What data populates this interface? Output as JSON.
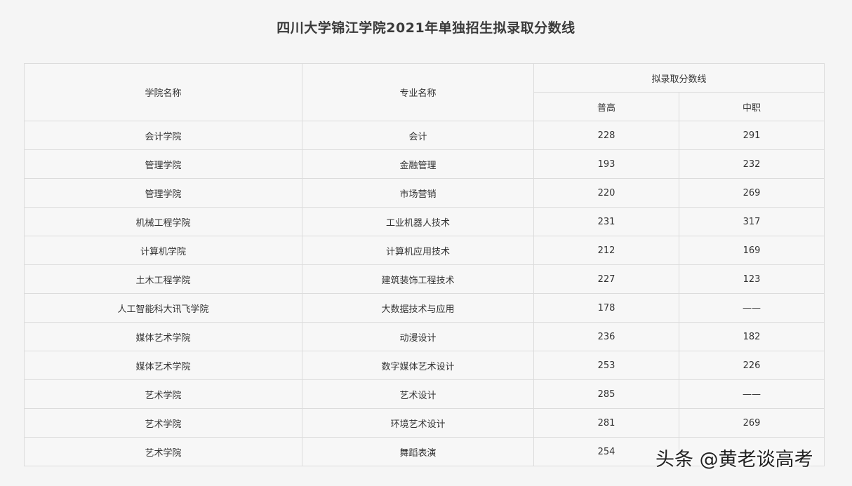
{
  "title": "四川大学锦江学院2021年单独招生拟录取分数线",
  "table": {
    "headers": {
      "college": "学院名称",
      "major": "专业名称",
      "score_group": "拟录取分数线",
      "putong": "普高",
      "zhongzhi": "中职"
    },
    "rows": [
      {
        "college": "会计学院",
        "major": "会计",
        "putong": "228",
        "zhongzhi": "291"
      },
      {
        "college": "管理学院",
        "major": "金融管理",
        "putong": "193",
        "zhongzhi": "232"
      },
      {
        "college": "管理学院",
        "major": "市场营销",
        "putong": "220",
        "zhongzhi": "269"
      },
      {
        "college": "机械工程学院",
        "major": "工业机器人技术",
        "putong": "231",
        "zhongzhi": "317"
      },
      {
        "college": "计算机学院",
        "major": "计算机应用技术",
        "putong": "212",
        "zhongzhi": "169"
      },
      {
        "college": "土木工程学院",
        "major": "建筑装饰工程技术",
        "putong": "227",
        "zhongzhi": "123"
      },
      {
        "college": "人工智能科大讯飞学院",
        "major": "大数据技术与应用",
        "putong": "178",
        "zhongzhi": "——"
      },
      {
        "college": "媒体艺术学院",
        "major": "动漫设计",
        "putong": "236",
        "zhongzhi": "182"
      },
      {
        "college": "媒体艺术学院",
        "major": "数字媒体艺术设计",
        "putong": "253",
        "zhongzhi": "226"
      },
      {
        "college": "艺术学院",
        "major": "艺术设计",
        "putong": "285",
        "zhongzhi": "——"
      },
      {
        "college": "艺术学院",
        "major": "环境艺术设计",
        "putong": "281",
        "zhongzhi": "269"
      },
      {
        "college": "艺术学院",
        "major": "舞蹈表演",
        "putong": "254",
        "zhongzhi": ""
      }
    ]
  },
  "watermark": "头条 @黄老谈高考"
}
